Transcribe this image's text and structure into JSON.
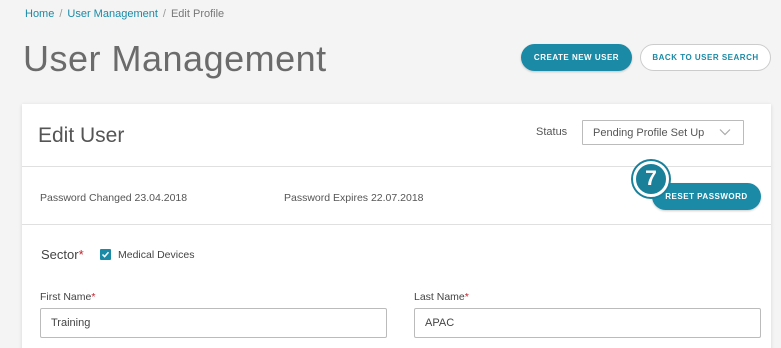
{
  "breadcrumb": {
    "home": "Home",
    "user_management": "User Management",
    "current": "Edit Profile"
  },
  "header": {
    "title": "User Management",
    "create_new_user": "CREATE NEW USER",
    "back_to_user_search": "BACK TO USER SEARCH"
  },
  "edit_user": {
    "title": "Edit User",
    "status_label": "Status",
    "status_value": "Pending Profile Set Up",
    "password_changed": "Password Changed 23.04.2018",
    "password_expires": "Password Expires 22.07.2018",
    "reset_password": "RESET PASSWORD",
    "step_number": "7",
    "sector_label": "Sector",
    "required_marker": "*",
    "sector_option": "Medical Devices",
    "sector_checked": true,
    "first_name_label": "First Name",
    "first_name_value": "Training",
    "last_name_label": "Last Name",
    "last_name_value": "APAC"
  },
  "colors": {
    "accent": "#1a8aa6",
    "required": "#c0202a"
  }
}
